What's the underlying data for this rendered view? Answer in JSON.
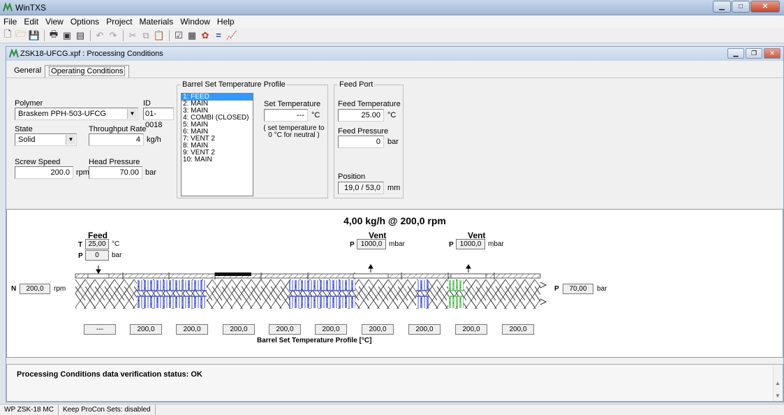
{
  "app": {
    "title": "WinTXS"
  },
  "menu": [
    "File",
    "Edit",
    "View",
    "Options",
    "Project",
    "Materials",
    "Window",
    "Help"
  ],
  "toolbar": [
    "new-file-icon",
    "open-folder-icon",
    "save-icon",
    "print-icon",
    "print-preview-icon",
    "report-icon",
    "undo-icon",
    "redo-icon",
    "cut-icon",
    "copy-icon",
    "paste-icon",
    "properties-icon",
    "calculator-icon",
    "gear-flower-icon",
    "equals-icon",
    "chart-icon"
  ],
  "child": {
    "title": "ZSK18-UFCG.xpf : Processing Conditions"
  },
  "tabs": [
    "General",
    "Operating Conditions"
  ],
  "polymer": {
    "label": "Polymer",
    "value": "Braskem PPH-503-UFCG",
    "id_label": "ID",
    "id_value": "01-0018"
  },
  "state": {
    "label": "State",
    "value": "Solid"
  },
  "throughput": {
    "label": "Throughput Rate",
    "value": "4",
    "unit": "kg/h"
  },
  "screw_speed": {
    "label": "Screw Speed",
    "value": "200.0",
    "unit": "rpm"
  },
  "head_pressure": {
    "label": "Head Pressure",
    "value": "70.00",
    "unit": "bar"
  },
  "barrel_profile": {
    "label": "Barrel Set Temperature Profile",
    "items": [
      "1: FEED",
      "2: MAIN",
      "3: MAIN",
      "4: COMBI (CLOSED)",
      "5: MAIN",
      "6: MAIN",
      "7: VENT 2",
      "8: MAIN",
      "9: VENT 2",
      "10: MAIN"
    ],
    "set_temp_label": "Set Temperature",
    "set_temp_value": "---",
    "set_temp_unit": "°C",
    "hint": "( set temperature to\n0 °C for neutral )"
  },
  "feed_port": {
    "label": "Feed Port",
    "temp_label": "Feed Temperature",
    "temp_value": "25.00",
    "temp_unit": "°C",
    "pressure_label": "Feed Pressure",
    "pressure_value": "0",
    "pressure_unit": "bar",
    "position_label": "Position",
    "position_value": "19,0 / 53,0",
    "position_unit": "mm"
  },
  "diagram": {
    "title": "4,00 kg/h @ 200,0 rpm",
    "feed": {
      "label": "Feed",
      "t_label": "T",
      "t_value": "25,00",
      "t_unit": "°C",
      "p_label": "P",
      "p_value": "0",
      "p_unit": "bar"
    },
    "vents": [
      {
        "label": "Vent",
        "p_label": "P",
        "p_value": "1000,0",
        "p_unit": "mbar"
      },
      {
        "label": "Vent",
        "p_label": "P",
        "p_value": "1000,0",
        "p_unit": "mbar"
      }
    ],
    "n": {
      "label": "N",
      "value": "200,0",
      "unit": "rpm"
    },
    "p_out": {
      "label": "P",
      "value": "70,00",
      "unit": "bar"
    },
    "barrel_temps": [
      "---",
      "200,0",
      "200,0",
      "200,0",
      "200,0",
      "200,0",
      "200,0",
      "200,0",
      "200,0",
      "200,0"
    ],
    "barrel_caption": "Barrel Set Temperature Profile [°C]"
  },
  "status": {
    "text": "Processing Conditions data verification status: OK"
  },
  "statusbar": [
    "WP ZSK-18 MC",
    "Keep ProCon Sets: disabled"
  ]
}
